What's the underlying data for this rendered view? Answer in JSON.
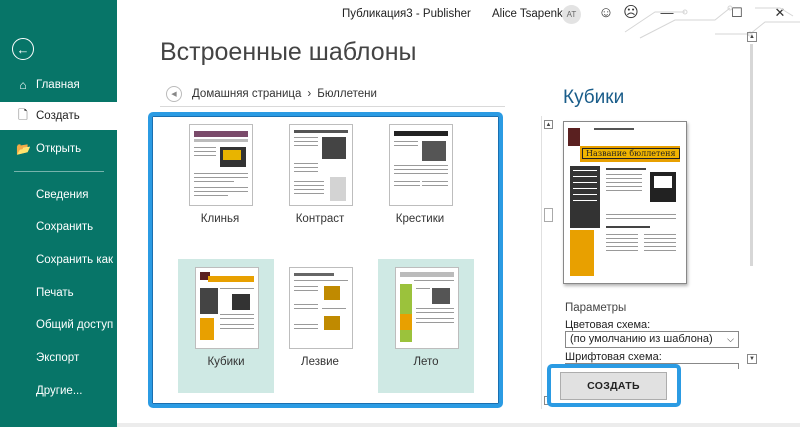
{
  "window": {
    "document_title": "Публикация3",
    "title_separator": " - ",
    "app_name": "Publisher",
    "user_name": "Alice Tsapenko",
    "user_initials": "AT",
    "minimize_glyph": "—",
    "maximize_glyph": "☐",
    "close_glyph": "✕"
  },
  "sidebar": {
    "background": "#077568",
    "back_icon": "←",
    "items": [
      {
        "label": "Главная",
        "icon": "⌂"
      },
      {
        "label": "Создать",
        "icon": "🗋"
      },
      {
        "label": "Открыть",
        "icon": "📂"
      },
      {
        "label": "Сведения"
      },
      {
        "label": "Сохранить"
      },
      {
        "label": "Сохранить как"
      },
      {
        "label": "Печать"
      },
      {
        "label": "Общий доступ"
      },
      {
        "label": "Экспорт"
      },
      {
        "label": "Другие..."
      }
    ]
  },
  "main": {
    "heading": "Встроенные шаблоны",
    "breadcrumb": {
      "home": "Домашняя страница",
      "separator": "›",
      "current": "Бюллетени"
    },
    "templates": [
      {
        "name": "Клинья"
      },
      {
        "name": "Контраст"
      },
      {
        "name": "Крестики"
      },
      {
        "name": "Кубики"
      },
      {
        "name": "Лезвие"
      },
      {
        "name": "Лето"
      }
    ],
    "highlight_color": "#2b9be3"
  },
  "preview": {
    "title": "Кубики",
    "banner_text": "Название бюллетеня",
    "params_label": "Параметры",
    "color_scheme_label": "Цветовая схема:",
    "color_scheme_value": "(по умолчанию из шаблона)",
    "font_scheme_label": "Шрифтовая схема:",
    "create_button": "СОЗДАТЬ"
  }
}
